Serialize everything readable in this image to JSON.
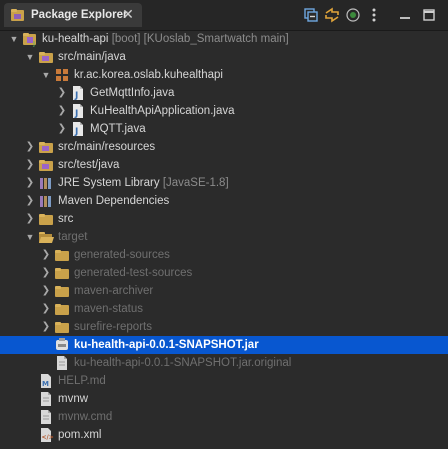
{
  "tab": {
    "title": "Package Explorer",
    "close_glyph": "✕"
  },
  "toolbar": {
    "icons": [
      "collapse-all-icon",
      "link-with-editor-icon",
      "focus-icon",
      "view-menu-icon",
      "minimize-icon",
      "maximize-icon"
    ]
  },
  "tree": [
    {
      "label": "ku-health-api",
      "decoration": "[boot] [KUoslab_Smartwatch main]",
      "depth": 0,
      "twisty": "expanded",
      "icon": "project-icon"
    },
    {
      "label": "src/main/java",
      "decoration": "",
      "depth": 1,
      "twisty": "expanded",
      "icon": "source-folder-icon"
    },
    {
      "label": "kr.ac.korea.oslab.kuhealthapi",
      "decoration": "",
      "depth": 2,
      "twisty": "expanded",
      "icon": "package-icon"
    },
    {
      "label": "GetMqttInfo.java",
      "decoration": "",
      "depth": 3,
      "twisty": "collapsed",
      "icon": "java-file-icon"
    },
    {
      "label": "KuHealthApiApplication.java",
      "decoration": "",
      "depth": 3,
      "twisty": "collapsed",
      "icon": "java-file-icon"
    },
    {
      "label": "MQTT.java",
      "decoration": "",
      "depth": 3,
      "twisty": "collapsed",
      "icon": "java-file-icon"
    },
    {
      "label": "src/main/resources",
      "decoration": "",
      "depth": 1,
      "twisty": "collapsed",
      "icon": "source-folder-icon"
    },
    {
      "label": "src/test/java",
      "decoration": "",
      "depth": 1,
      "twisty": "collapsed",
      "icon": "source-folder-icon"
    },
    {
      "label": "JRE System Library",
      "decoration": "[JavaSE-1.8]",
      "depth": 1,
      "twisty": "collapsed",
      "icon": "library-icon"
    },
    {
      "label": "Maven Dependencies",
      "decoration": "",
      "depth": 1,
      "twisty": "collapsed",
      "icon": "library-icon"
    },
    {
      "label": "src",
      "decoration": "",
      "depth": 1,
      "twisty": "collapsed",
      "icon": "folder-icon"
    },
    {
      "label": "target",
      "decoration": "",
      "depth": 1,
      "twisty": "expanded",
      "icon": "open-folder-icon",
      "dim": true
    },
    {
      "label": "generated-sources",
      "decoration": "",
      "depth": 2,
      "twisty": "collapsed",
      "icon": "folder-icon",
      "dim": true
    },
    {
      "label": "generated-test-sources",
      "decoration": "",
      "depth": 2,
      "twisty": "collapsed",
      "icon": "folder-icon",
      "dim": true
    },
    {
      "label": "maven-archiver",
      "decoration": "",
      "depth": 2,
      "twisty": "collapsed",
      "icon": "folder-icon",
      "dim": true
    },
    {
      "label": "maven-status",
      "decoration": "",
      "depth": 2,
      "twisty": "collapsed",
      "icon": "folder-icon",
      "dim": true
    },
    {
      "label": "surefire-reports",
      "decoration": "",
      "depth": 2,
      "twisty": "collapsed",
      "icon": "folder-icon",
      "dim": true
    },
    {
      "label": "ku-health-api-0.0.1-SNAPSHOT.jar",
      "decoration": "",
      "depth": 2,
      "twisty": "none",
      "icon": "jar-file-icon",
      "selected": true
    },
    {
      "label": "ku-health-api-0.0.1-SNAPSHOT.jar.original",
      "decoration": "",
      "depth": 2,
      "twisty": "none",
      "icon": "file-icon",
      "dim": true
    },
    {
      "label": "HELP.md",
      "decoration": "",
      "depth": 1,
      "twisty": "none",
      "icon": "markdown-file-icon",
      "dim": true
    },
    {
      "label": "mvnw",
      "decoration": "",
      "depth": 1,
      "twisty": "none",
      "icon": "file-icon"
    },
    {
      "label": "mvnw.cmd",
      "decoration": "",
      "depth": 1,
      "twisty": "none",
      "icon": "file-icon",
      "dim": true
    },
    {
      "label": "pom.xml",
      "decoration": "",
      "depth": 1,
      "twisty": "none",
      "icon": "xml-file-icon"
    }
  ]
}
